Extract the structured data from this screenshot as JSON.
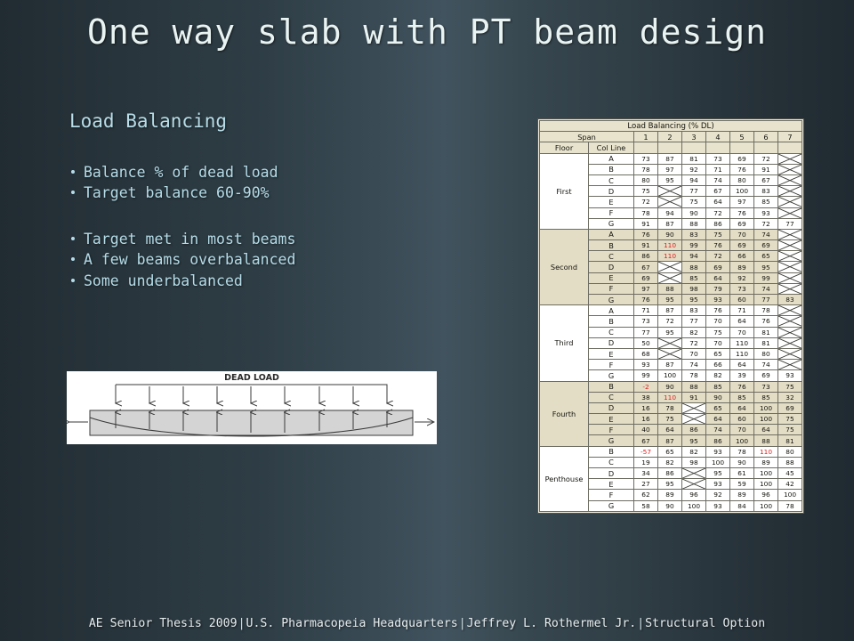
{
  "slide": {
    "title": "One way slab with PT beam design",
    "section_heading": "Load Balancing"
  },
  "bullets_group_1": [
    "Balance % of dead load",
    "Target balance 60-90%"
  ],
  "bullets_group_2": [
    "Target met in most beams",
    "A few beams overbalanced",
    "Some underbalanced"
  ],
  "diagram": {
    "label": "DEAD LOAD",
    "down_arrow_count": 9,
    "up_arrow_count": 9,
    "beam_fill": "#d4d4d4",
    "line_color": "#3a3a3a"
  },
  "table": {
    "title": "Load Balancing (% DL)",
    "span_label": "Span",
    "floor_label": "Floor",
    "col_line_label": "Col Line",
    "span_numbers": [
      "1",
      "2",
      "3",
      "4",
      "5",
      "6",
      "7"
    ],
    "red_color": "#e02020",
    "floors": [
      {
        "name": "First",
        "band": "light",
        "rows": [
          {
            "col": "A",
            "values": [
              "73",
              "87",
              "81",
              "73",
              "69",
              "72",
              "X"
            ],
            "red": []
          },
          {
            "col": "B",
            "values": [
              "78",
              "97",
              "92",
              "71",
              "76",
              "91",
              "X"
            ],
            "red": []
          },
          {
            "col": "C",
            "values": [
              "80",
              "95",
              "94",
              "74",
              "80",
              "67",
              "X"
            ],
            "red": []
          },
          {
            "col": "D",
            "values": [
              "75",
              "X",
              "77",
              "67",
              "100",
              "83",
              "X"
            ],
            "red": []
          },
          {
            "col": "E",
            "values": [
              "72",
              "X",
              "75",
              "64",
              "97",
              "85",
              "X"
            ],
            "red": []
          },
          {
            "col": "F",
            "values": [
              "78",
              "94",
              "90",
              "72",
              "76",
              "93",
              "X"
            ],
            "red": []
          },
          {
            "col": "G",
            "values": [
              "91",
              "87",
              "88",
              "86",
              "69",
              "72",
              "77"
            ],
            "red": []
          }
        ]
      },
      {
        "name": "Second",
        "band": "dark",
        "rows": [
          {
            "col": "A",
            "values": [
              "76",
              "90",
              "83",
              "75",
              "70",
              "74",
              "X"
            ],
            "red": []
          },
          {
            "col": "B",
            "values": [
              "91",
              "110",
              "99",
              "76",
              "69",
              "69",
              "X"
            ],
            "red": [
              1
            ]
          },
          {
            "col": "C",
            "values": [
              "86",
              "110",
              "94",
              "72",
              "66",
              "65",
              "X"
            ],
            "red": [
              1
            ]
          },
          {
            "col": "D",
            "values": [
              "67",
              "X",
              "88",
              "69",
              "89",
              "95",
              "X"
            ],
            "red": []
          },
          {
            "col": "E",
            "values": [
              "69",
              "X",
              "85",
              "64",
              "92",
              "99",
              "X"
            ],
            "red": []
          },
          {
            "col": "F",
            "values": [
              "97",
              "88",
              "98",
              "79",
              "73",
              "74",
              "X"
            ],
            "red": []
          },
          {
            "col": "G",
            "values": [
              "76",
              "95",
              "95",
              "93",
              "60",
              "77",
              "83"
            ],
            "red": []
          }
        ]
      },
      {
        "name": "Third",
        "band": "light",
        "rows": [
          {
            "col": "A",
            "values": [
              "71",
              "87",
              "83",
              "76",
              "71",
              "78",
              "X"
            ],
            "red": []
          },
          {
            "col": "B",
            "values": [
              "73",
              "72",
              "77",
              "70",
              "64",
              "76",
              "X"
            ],
            "red": []
          },
          {
            "col": "C",
            "values": [
              "77",
              "95",
              "82",
              "75",
              "70",
              "81",
              "X"
            ],
            "red": []
          },
          {
            "col": "D",
            "values": [
              "50",
              "X",
              "72",
              "70",
              "110",
              "81",
              "X"
            ],
            "red": []
          },
          {
            "col": "E",
            "values": [
              "68",
              "X",
              "70",
              "65",
              "110",
              "80",
              "X"
            ],
            "red": []
          },
          {
            "col": "F",
            "values": [
              "93",
              "87",
              "74",
              "66",
              "64",
              "74",
              "X"
            ],
            "red": []
          },
          {
            "col": "G",
            "values": [
              "99",
              "100",
              "78",
              "82",
              "39",
              "69",
              "93"
            ],
            "red": []
          }
        ]
      },
      {
        "name": "Fourth",
        "band": "dark",
        "rows": [
          {
            "col": "B",
            "values": [
              "-2",
              "90",
              "88",
              "85",
              "76",
              "73",
              "75"
            ],
            "red": [
              0
            ]
          },
          {
            "col": "C",
            "values": [
              "38",
              "110",
              "91",
              "90",
              "85",
              "85",
              "32"
            ],
            "red": [
              1
            ]
          },
          {
            "col": "D",
            "values": [
              "16",
              "78",
              "X",
              "65",
              "64",
              "100",
              "69"
            ],
            "red": []
          },
          {
            "col": "E",
            "values": [
              "16",
              "75",
              "X",
              "64",
              "60",
              "100",
              "75"
            ],
            "red": []
          },
          {
            "col": "F",
            "values": [
              "40",
              "64",
              "86",
              "74",
              "70",
              "64",
              "75"
            ],
            "red": []
          },
          {
            "col": "G",
            "values": [
              "67",
              "87",
              "95",
              "86",
              "100",
              "88",
              "81"
            ],
            "red": []
          }
        ]
      },
      {
        "name": "Penthouse",
        "band": "light",
        "rows": [
          {
            "col": "B",
            "values": [
              "-57",
              "65",
              "82",
              "93",
              "78",
              "110",
              "80"
            ],
            "red": [
              0,
              5
            ]
          },
          {
            "col": "C",
            "values": [
              "19",
              "82",
              "98",
              "100",
              "90",
              "89",
              "88"
            ],
            "red": []
          },
          {
            "col": "D",
            "values": [
              "34",
              "86",
              "X",
              "95",
              "61",
              "100",
              "45"
            ],
            "red": []
          },
          {
            "col": "E",
            "values": [
              "27",
              "95",
              "X",
              "93",
              "59",
              "100",
              "42"
            ],
            "red": []
          },
          {
            "col": "F",
            "values": [
              "62",
              "89",
              "96",
              "92",
              "89",
              "96",
              "100"
            ],
            "red": []
          },
          {
            "col": "G",
            "values": [
              "58",
              "90",
              "100",
              "93",
              "84",
              "100",
              "78"
            ],
            "red": []
          }
        ]
      }
    ]
  },
  "footer": {
    "items": [
      "AE Senior Thesis 2009",
      "U.S. Pharmacopeia Headquarters",
      "Jeffrey L. Rothermel Jr.",
      "Structural Option"
    ],
    "separator": "|"
  }
}
